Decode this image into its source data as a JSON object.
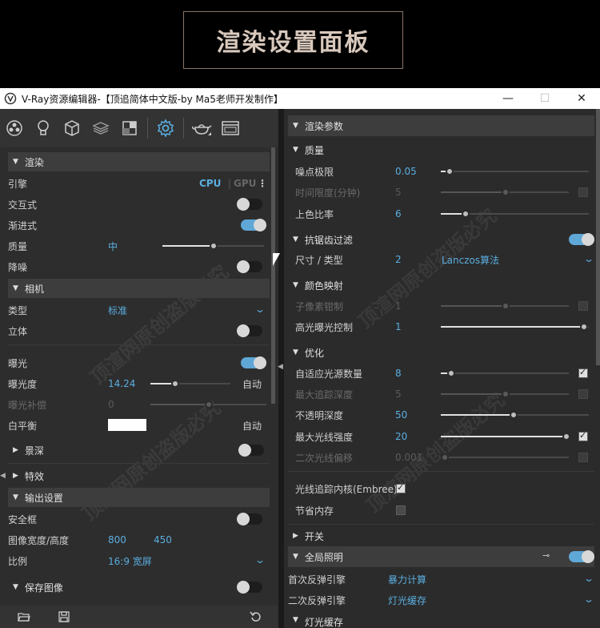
{
  "banner": {
    "title": "渲染设置面板"
  },
  "window": {
    "title": "V-Ray资源编辑器-【顶追简体中文版-by Ma5老师开发制作】",
    "minimize": "—",
    "maximize": "☐",
    "close": "✕"
  },
  "watermark": "顶渲网原创盗版必究",
  "left": {
    "render_section": "渲染",
    "engine_label": "引擎",
    "engine_cpu": "CPU",
    "engine_gpu": "GPU",
    "interactive_label": "交互式",
    "progressive_label": "渐进式",
    "quality_label": "质量",
    "quality_value": "中",
    "quality_level": 0.5,
    "denoise_label": "降噪",
    "camera_section": "相机",
    "type_label": "类型",
    "type_value": "标准",
    "stereo_label": "立体",
    "exposure_label": "曝光",
    "ev_label": "曝光度",
    "ev_value": "14.24",
    "ev_auto": "自动",
    "ev_comp_label": "曝光补偿",
    "ev_comp_value": "0",
    "wb_label": "白平衡",
    "wb_auto": "自动",
    "wb_color": "#ffffff",
    "dof_section": "景深",
    "effects_section": "特效",
    "output_section": "输出设置",
    "safe_frame_label": "安全框",
    "size_label": "图像宽度/高度",
    "width_value": "800",
    "height_value": "450",
    "ratio_label": "比例",
    "ratio_value": "16:9 宽屏",
    "save_section": "保存图像"
  },
  "right": {
    "render_params": "渲染参数",
    "quality_section": "质量",
    "noise_label": "噪点极限",
    "noise_value": "0.05",
    "time_label": "时间限度(分钟)",
    "time_value": "5",
    "shading_label": "上色比率",
    "shading_value": "6",
    "aa_section": "抗锯齿过滤",
    "filter_label": "尺寸 / 类型",
    "filter_size": "2",
    "filter_type": "Lanczos算法",
    "color_section": "颜色映射",
    "subpixel_label": "子像素钳制",
    "subpixel_value": "1",
    "highlight_label": "高光曝光控制",
    "highlight_value": "1",
    "optimize_section": "优化",
    "adaptive_label": "自适应光源数量",
    "adaptive_value": "8",
    "maxdepth_label": "最大追踪深度",
    "maxdepth_value": "5",
    "opacity_label": "不透明深度",
    "opacity_value": "50",
    "maxray_label": "最大光线强度",
    "maxray_value": "20",
    "secondary_label": "二次光线偏移",
    "secondary_value": "0.001",
    "embree_label": "光线追踪内核(Embree)",
    "memory_label": "节省内存",
    "switch_section": "开关",
    "gi_section": "全局照明",
    "primary_label": "首次反弹引擎",
    "primary_value": "暴力计算",
    "secondary_engine_label": "二次反弹引擎",
    "secondary_engine_value": "灯光缓存",
    "lightcache_section": "灯光缓存"
  },
  "colors": {
    "accent": "#5aaee0",
    "toggle_on": "#5fa7d6",
    "panel": "#2d2d2d"
  }
}
